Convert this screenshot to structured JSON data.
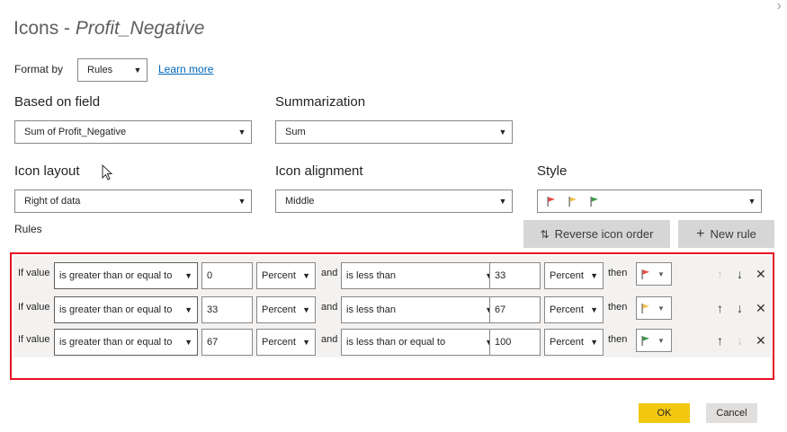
{
  "dialog": {
    "title_prefix": "Icons - ",
    "title_field": "Profit_Negative",
    "close_glyph": "›"
  },
  "format_by": {
    "label": "Format by",
    "value": "Rules",
    "learn_more": "Learn more"
  },
  "based_on_field": {
    "label": "Based on field",
    "value": "Sum of Profit_Negative"
  },
  "summarization": {
    "label": "Summarization",
    "value": "Sum"
  },
  "icon_layout": {
    "label": "Icon layout",
    "value": "Right of data"
  },
  "icon_alignment": {
    "label": "Icon alignment",
    "value": "Middle"
  },
  "style": {
    "label": "Style",
    "icons": [
      "flag-red-icon",
      "flag-yellow-icon",
      "flag-green-icon"
    ]
  },
  "rules": {
    "label": "Rules",
    "reverse_label": "Reverse icon order",
    "new_rule_label": "New rule",
    "if_value": "If value",
    "and": "and",
    "then": "then",
    "items": [
      {
        "op1": "is greater than or equal to",
        "v1": "0",
        "u1": "Percent",
        "op2": "is less than",
        "v2": "33",
        "u2": "Percent",
        "icon": "flag-red-icon",
        "color": "#e8473f"
      },
      {
        "op1": "is greater than or equal to",
        "v1": "33",
        "u1": "Percent",
        "op2": "is less than",
        "v2": "67",
        "u2": "Percent",
        "icon": "flag-yellow-icon",
        "color": "#f2c14e"
      },
      {
        "op1": "is greater than or equal to",
        "v1": "67",
        "u1": "Percent",
        "op2": "is less than or equal to",
        "v2": "100",
        "u2": "Percent",
        "icon": "flag-green-icon",
        "color": "#3a9a4a"
      }
    ]
  },
  "footer": {
    "ok": "OK",
    "cancel": "Cancel"
  },
  "colors": {
    "accent_ok": "#f2c811",
    "highlight_border": "#e81123",
    "link": "#0067b8"
  }
}
